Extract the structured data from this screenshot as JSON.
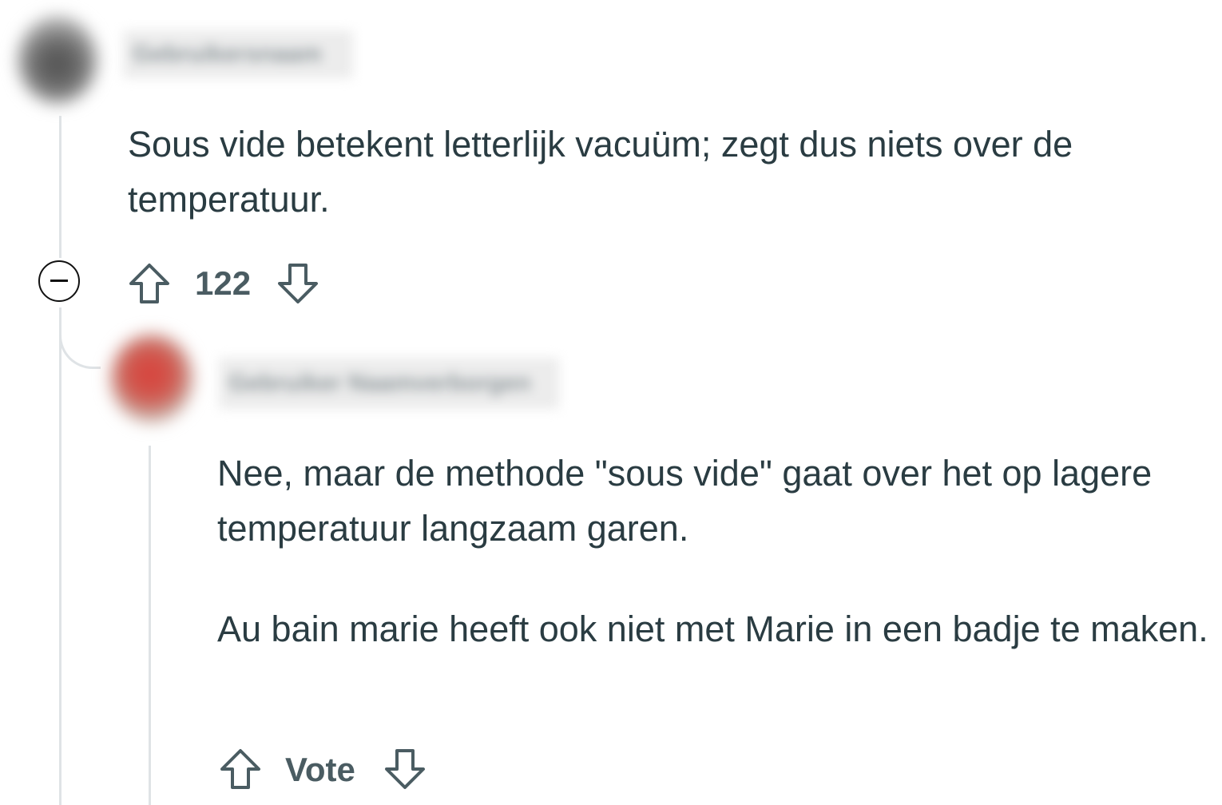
{
  "comments": [
    {
      "username": "Gebruikersnaam",
      "body": "Sous vide betekent letterlijk vacuüm; zegt dus niets over de temperatuur.",
      "score": "122"
    },
    {
      "username": "Gebruiker Naamverborgen",
      "paragraphs": [
        "Nee, maar de methode \"sous vide\" gaat over het op lagere temperatuur langzaam garen.",
        "Au bain marie heeft ook niet met Marie in een badje te maken."
      ],
      "score": "Vote"
    }
  ],
  "icons": {
    "upvote": "arrow-up-icon",
    "downvote": "arrow-down-icon",
    "collapse": "minus-circle-icon"
  },
  "colors": {
    "text": "#2a3c42",
    "action_text": "#4a5c62",
    "thread_line": "#dfe3e6"
  }
}
